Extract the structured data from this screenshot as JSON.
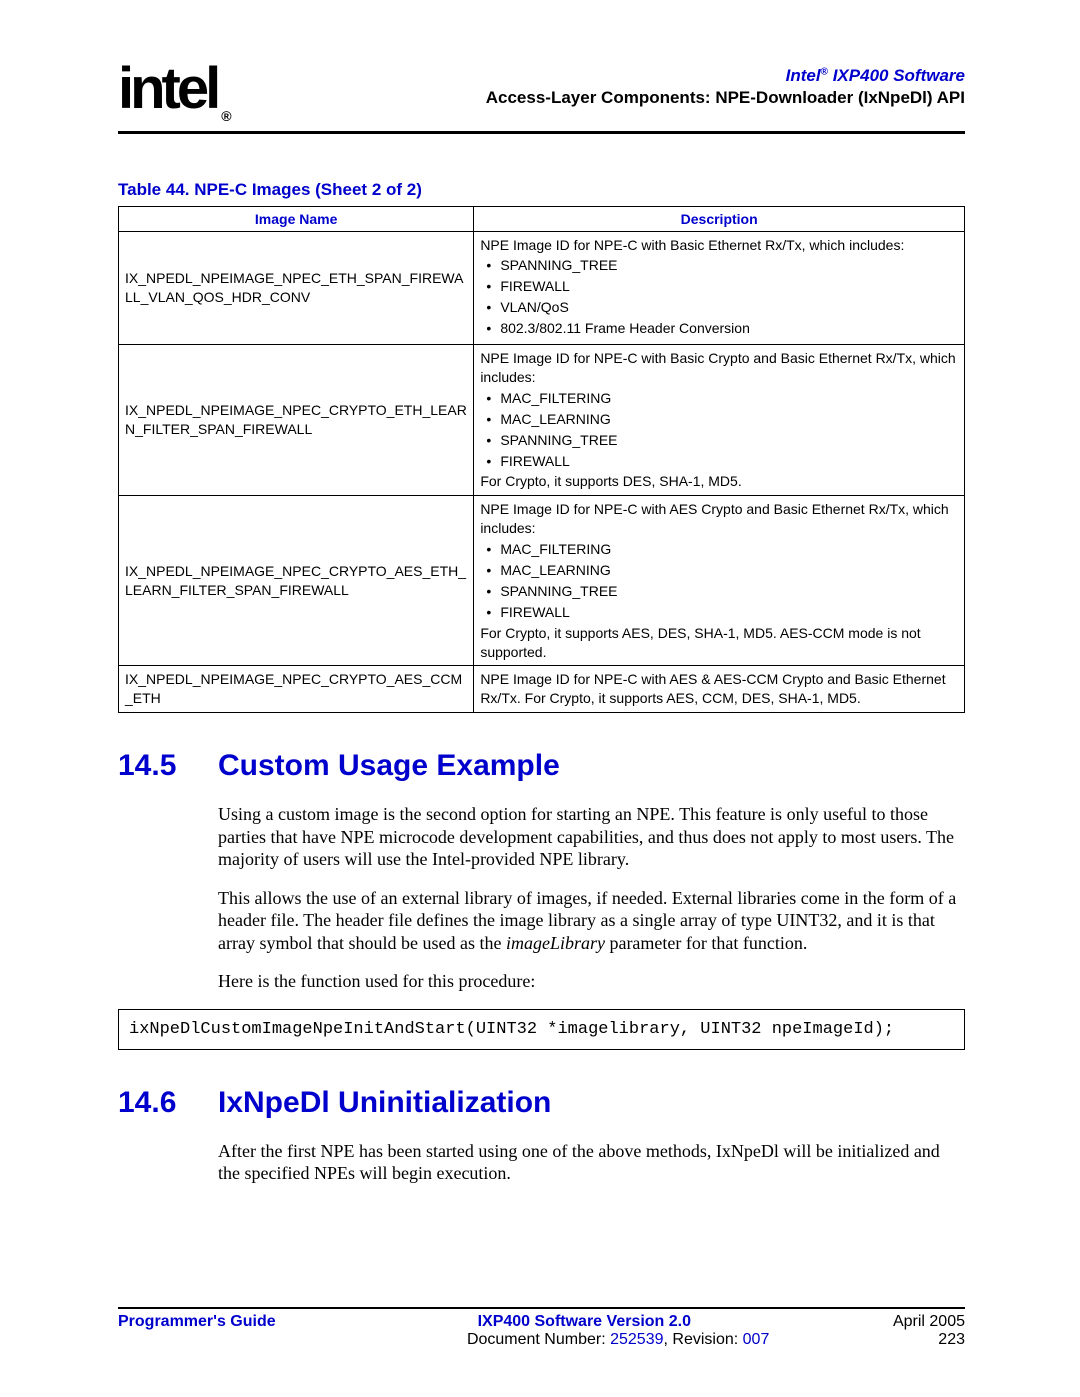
{
  "header": {
    "logo_text": "intel",
    "product": "Intel",
    "product_suffix": " IXP400 Software",
    "chapter": "Access-Layer Components: NPE-Downloader (IxNpeDl) API"
  },
  "table": {
    "caption": "Table 44.  NPE-C Images (Sheet 2 of 2)",
    "col1": "Image Name",
    "col2": "Description",
    "rows": [
      {
        "name": "IX_NPEDL_NPEIMAGE_NPEC_ETH_SPAN_FIREWALL_VLAN_QOS_HDR_CONV",
        "desc_lead": "NPE Image ID for NPE-C with Basic Ethernet Rx/Tx, which includes:",
        "items": [
          "SPANNING_TREE",
          "FIREWALL",
          "VLAN/QoS",
          "802.3/802.11 Frame Header Conversion"
        ],
        "desc_tail": ""
      },
      {
        "name": "IX_NPEDL_NPEIMAGE_NPEC_CRYPTO_ETH_LEARN_FILTER_SPAN_FIREWALL",
        "desc_lead": "NPE Image ID for NPE-C with Basic Crypto and Basic Ethernet Rx/Tx, which includes:",
        "items": [
          "MAC_FILTERING",
          "MAC_LEARNING",
          "SPANNING_TREE",
          "FIREWALL"
        ],
        "desc_tail": "For Crypto, it supports DES, SHA-1, MD5."
      },
      {
        "name": "IX_NPEDL_NPEIMAGE_NPEC_CRYPTO_AES_ETH_LEARN_FILTER_SPAN_FIREWALL",
        "desc_lead": "NPE Image ID for NPE-C with AES Crypto and Basic Ethernet Rx/Tx, which includes:",
        "items": [
          "MAC_FILTERING",
          "MAC_LEARNING",
          "SPANNING_TREE",
          "FIREWALL"
        ],
        "desc_tail": "For Crypto, it supports AES, DES, SHA-1, MD5. AES-CCM mode is not supported."
      },
      {
        "name": "IX_NPEDL_NPEIMAGE_NPEC_CRYPTO_AES_CCM_ETH",
        "desc_lead": "NPE Image ID for NPE-C with AES & AES-CCM Crypto and Basic Ethernet Rx/Tx. For Crypto, it supports AES, CCM, DES, SHA-1, MD5.",
        "items": [],
        "desc_tail": ""
      }
    ]
  },
  "section1": {
    "num": "14.5",
    "title": "Custom Usage Example",
    "para1": "Using a custom image is the second option for starting an NPE. This feature is only useful to those parties that have NPE microcode development capabilities, and thus does not apply to most users. The majority of users will use the Intel-provided NPE library.",
    "para2a": "This allows the use of an external library of images, if needed. External libraries come in the form of a header file. The header file defines the image library as a single array of type UINT32, and it is that array symbol that should be used as the ",
    "para2_ital": "imageLibrary",
    "para2b": " parameter for that function.",
    "para3": "Here is the function used for this procedure:",
    "code": "ixNpeDlCustomImageNpeInitAndStart(UINT32 *imagelibrary, UINT32 npeImageId);"
  },
  "section2": {
    "num": "14.6",
    "title": "IxNpeDl Uninitialization",
    "para1": "After the first NPE has been started using one of the above methods, IxNpeDl will be initialized and the specified NPEs will begin execution."
  },
  "footer": {
    "left": "Programmer's Guide",
    "center_bold": "IXP400 Software Version 2.0",
    "right1": "April 2005",
    "doc_label": "Document Number: ",
    "doc_num": "252539",
    "rev_label": ", Revision: ",
    "rev_num": "007",
    "page": "223"
  }
}
